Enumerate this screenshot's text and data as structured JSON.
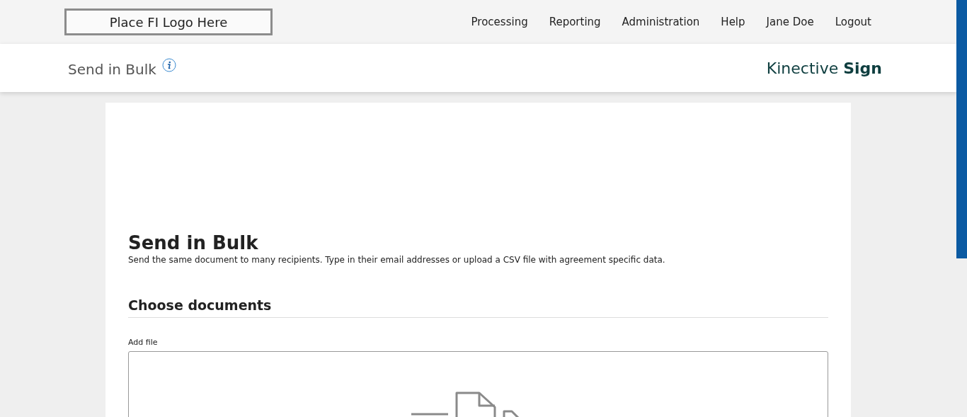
{
  "header": {
    "logo_placeholder": "Place FI Logo Here",
    "nav": [
      "Processing",
      "Reporting",
      "Administration",
      "Help",
      "Jane Doe",
      "Logout"
    ]
  },
  "subheader": {
    "title": "Send in Bulk",
    "brand_light": "Kinective",
    "brand_bold": "Sign"
  },
  "card": {
    "title": "Send in Bulk",
    "description": "Send the same document to many recipients. Type in their email addresses or upload a CSV file with agreement specific data.",
    "section_title": "Choose documents",
    "field_label": "Add file"
  }
}
